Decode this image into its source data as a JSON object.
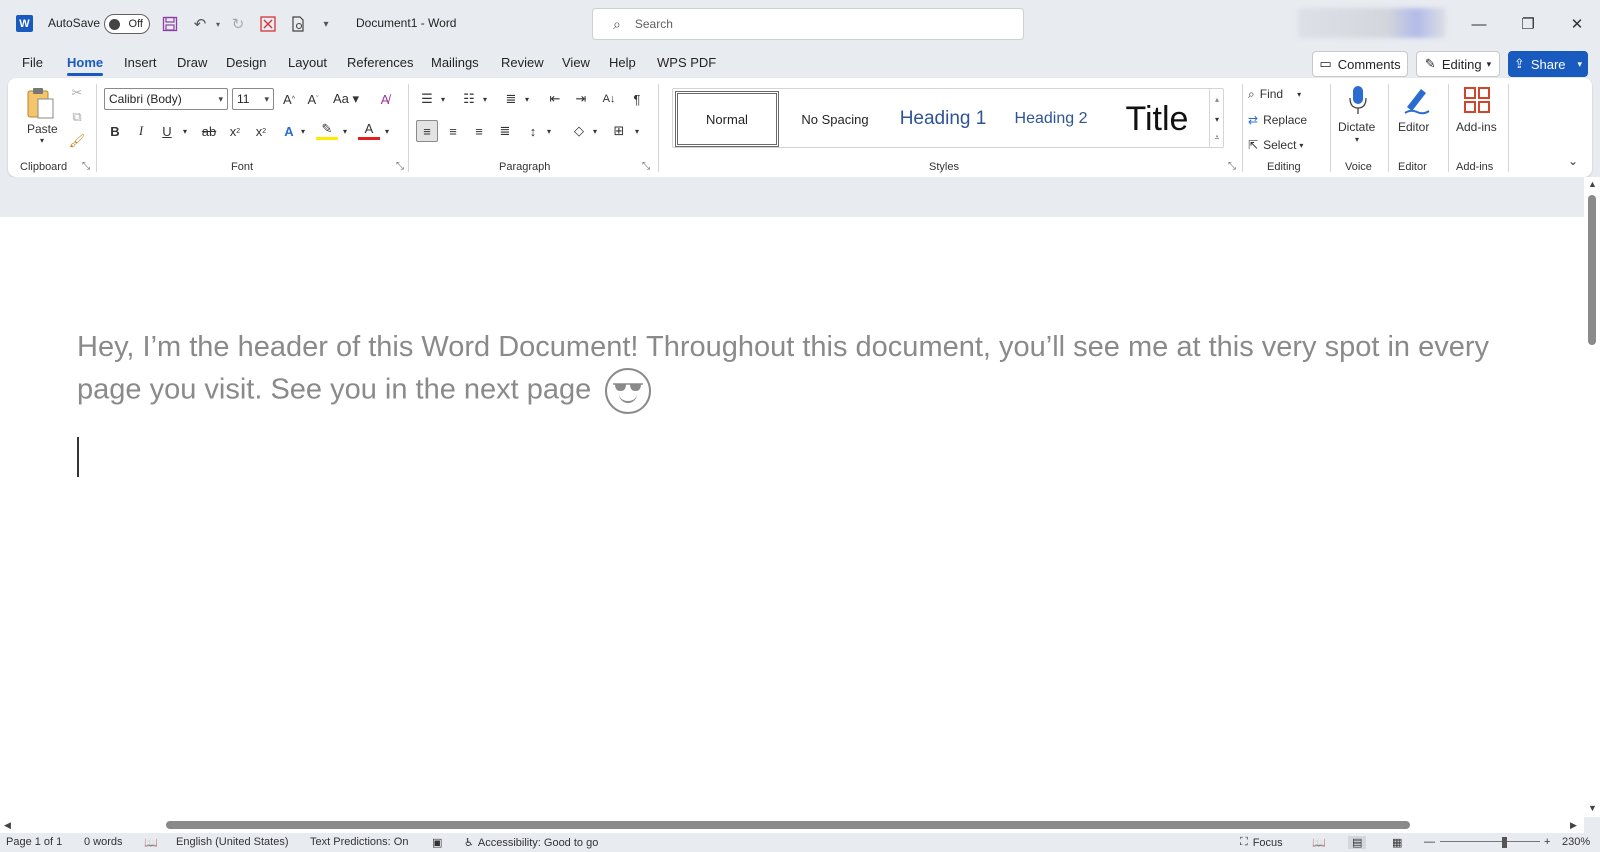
{
  "app": {
    "autosave_label": "AutoSave",
    "autosave_state": "Off",
    "document_title": "Document1  -  Word",
    "search_placeholder": "Search"
  },
  "tabs": [
    "File",
    "Home",
    "Insert",
    "Draw",
    "Design",
    "Layout",
    "References",
    "Mailings",
    "Review",
    "View",
    "Help",
    "WPS PDF"
  ],
  "active_tab": "Home",
  "top_right": {
    "comments": "Comments",
    "editing": "Editing",
    "share": "Share"
  },
  "ribbon": {
    "clipboard": {
      "paste": "Paste",
      "label": "Clipboard"
    },
    "font": {
      "name": "Calibri (Body)",
      "size": "11",
      "label": "Font"
    },
    "paragraph": {
      "label": "Paragraph"
    },
    "styles": {
      "items": [
        "Normal",
        "No Spacing",
        "Heading 1",
        "Heading 2",
        "Title"
      ],
      "label": "Styles"
    },
    "editing": {
      "find": "Find",
      "replace": "Replace",
      "select": "Select",
      "label": "Editing"
    },
    "voice": {
      "dictate": "Dictate",
      "label": "Voice"
    },
    "editor": {
      "editor": "Editor",
      "label": "Editor"
    },
    "addins": {
      "addins": "Add-ins",
      "label": "Add-ins"
    }
  },
  "document": {
    "header_text": "Hey, I’m the header of this Word Document! Throughout this document, you’ll see me at this very spot in every page you visit. See you in the next page"
  },
  "status": {
    "page": "Page 1 of 1",
    "words": "0 words",
    "language": "English (United States)",
    "predictions": "Text Predictions: On",
    "accessibility": "Accessibility: Good to go",
    "focus": "Focus",
    "zoom": "230%"
  }
}
